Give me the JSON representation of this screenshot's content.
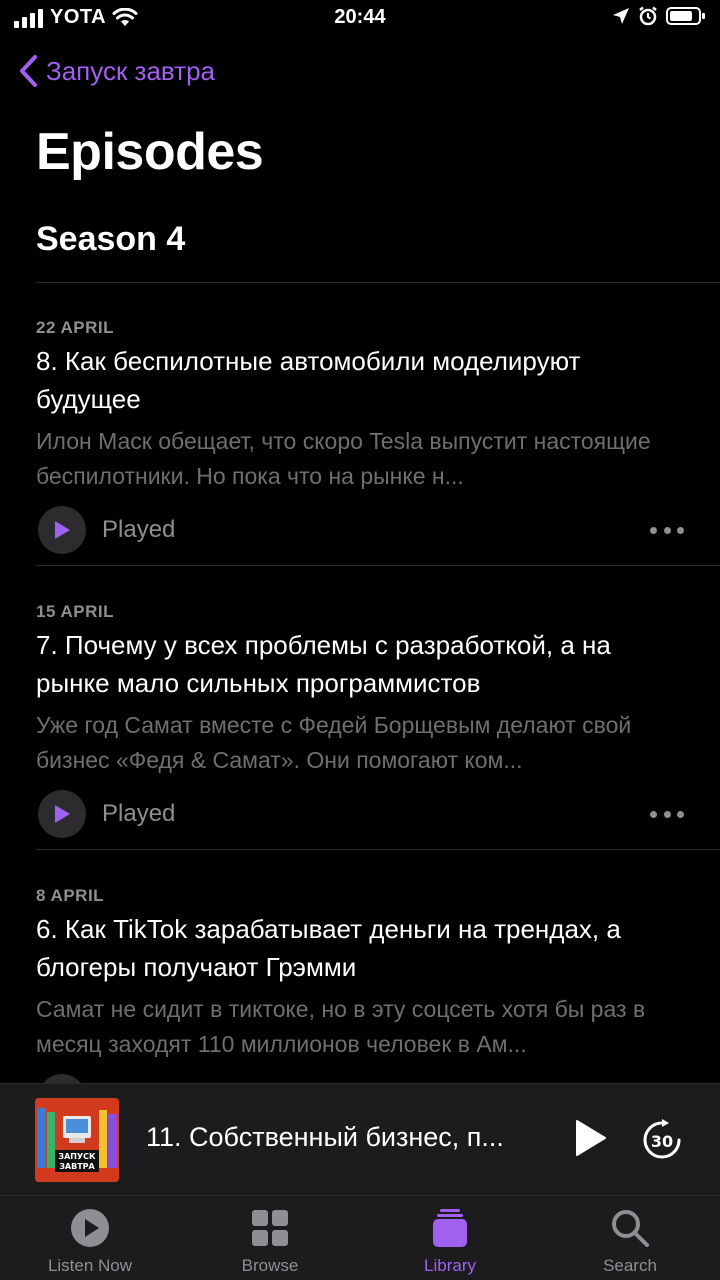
{
  "status_bar": {
    "carrier": "YOTA",
    "time": "20:44"
  },
  "nav": {
    "back_label": "Запуск завтра"
  },
  "page": {
    "title": "Episodes",
    "season": "Season 4"
  },
  "episodes": [
    {
      "date": "22 APRIL",
      "title": "8. Как беспилотные автомобили моделируют будущее",
      "description": "Илон Маск обещает, что скоро Tesla выпустит настоящие беспилотники. Но пока что на рынке н...",
      "status": "Played"
    },
    {
      "date": "15 APRIL",
      "title": "7. Почему у всех проблемы с разработкой, а на рынке мало сильных программистов",
      "description": "Уже год Самат вместе с Федей Борщевым делают свой бизнес «Федя & Самат». Они помогают ком...",
      "status": "Played"
    },
    {
      "date": "8 APRIL",
      "title": "6. Как TikTok зарабатывает деньги на трендах, а блогеры получают Грэмми",
      "description": "Самат не сидит в тиктоке, но в эту соцсеть хотя бы раз в месяц заходят 110 миллионов человек в Ам..."
    }
  ],
  "mini_player": {
    "title": "11. Собственный бизнес, п...",
    "skip_seconds": "30",
    "artwork_text": "ЗАПУСК ЗАВТРА"
  },
  "tabs": [
    {
      "label": "Listen Now",
      "icon": "play-circle-icon"
    },
    {
      "label": "Browse",
      "icon": "grid-icon"
    },
    {
      "label": "Library",
      "icon": "library-icon",
      "active": true
    },
    {
      "label": "Search",
      "icon": "search-icon"
    }
  ],
  "colors": {
    "accent": "#a060f0",
    "background": "#000000",
    "secondary_text": "#8e8e93"
  }
}
